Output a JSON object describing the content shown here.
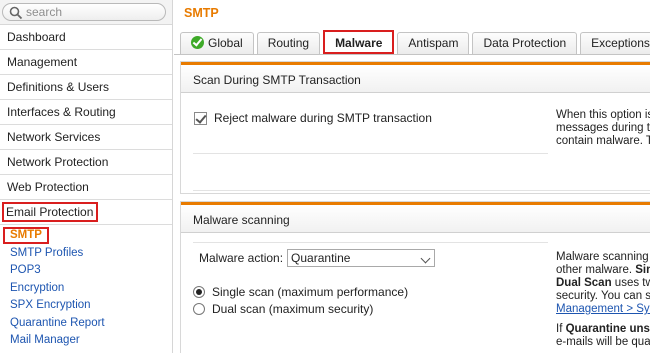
{
  "search": {
    "placeholder": "search"
  },
  "sidebar": {
    "items": [
      {
        "label": "Dashboard"
      },
      {
        "label": "Management"
      },
      {
        "label": "Definitions & Users"
      },
      {
        "label": "Interfaces & Routing"
      },
      {
        "label": "Network Services"
      },
      {
        "label": "Network Protection"
      },
      {
        "label": "Web Protection"
      },
      {
        "label": "Email Protection"
      }
    ],
    "sub_items": [
      {
        "label": "SMTP"
      },
      {
        "label": "SMTP Profiles"
      },
      {
        "label": "POP3"
      },
      {
        "label": "Encryption"
      },
      {
        "label": "SPX Encryption"
      },
      {
        "label": "Quarantine Report"
      },
      {
        "label": "Mail Manager"
      }
    ]
  },
  "main": {
    "title": "SMTP",
    "tabs": [
      {
        "label": "Global"
      },
      {
        "label": "Routing"
      },
      {
        "label": "Malware"
      },
      {
        "label": "Antispam"
      },
      {
        "label": "Data Protection"
      },
      {
        "label": "Exceptions"
      }
    ],
    "section1": {
      "title": "Scan During SMTP Transaction",
      "checkbox_label": "Reject malware during SMTP transaction",
      "help_lines": [
        "When this option is",
        "messages during th",
        "contain malware. T"
      ]
    },
    "section2": {
      "title": "Malware scanning",
      "action_label": "Malware action:",
      "action_value": "Quarantine",
      "radio_single": "Single scan (maximum performance)",
      "radio_dual": "Dual scan (maximum security)",
      "help": {
        "line1": "Malware scanning c",
        "line2a": "other malware. ",
        "line2b": "Sin",
        "line3a": "Dual Scan",
        "line3b": " uses tw",
        "line4": "security. You can s",
        "link": "Management > Sys",
        "line6a": "If ",
        "line6b": "Quarantine unsc",
        "line7": "e-mails will be qua"
      }
    }
  },
  "colors": {
    "accent": "#e87b00",
    "highlight": "#d91e1e",
    "link": "#1d55b0",
    "ok": "#3eaa28"
  }
}
